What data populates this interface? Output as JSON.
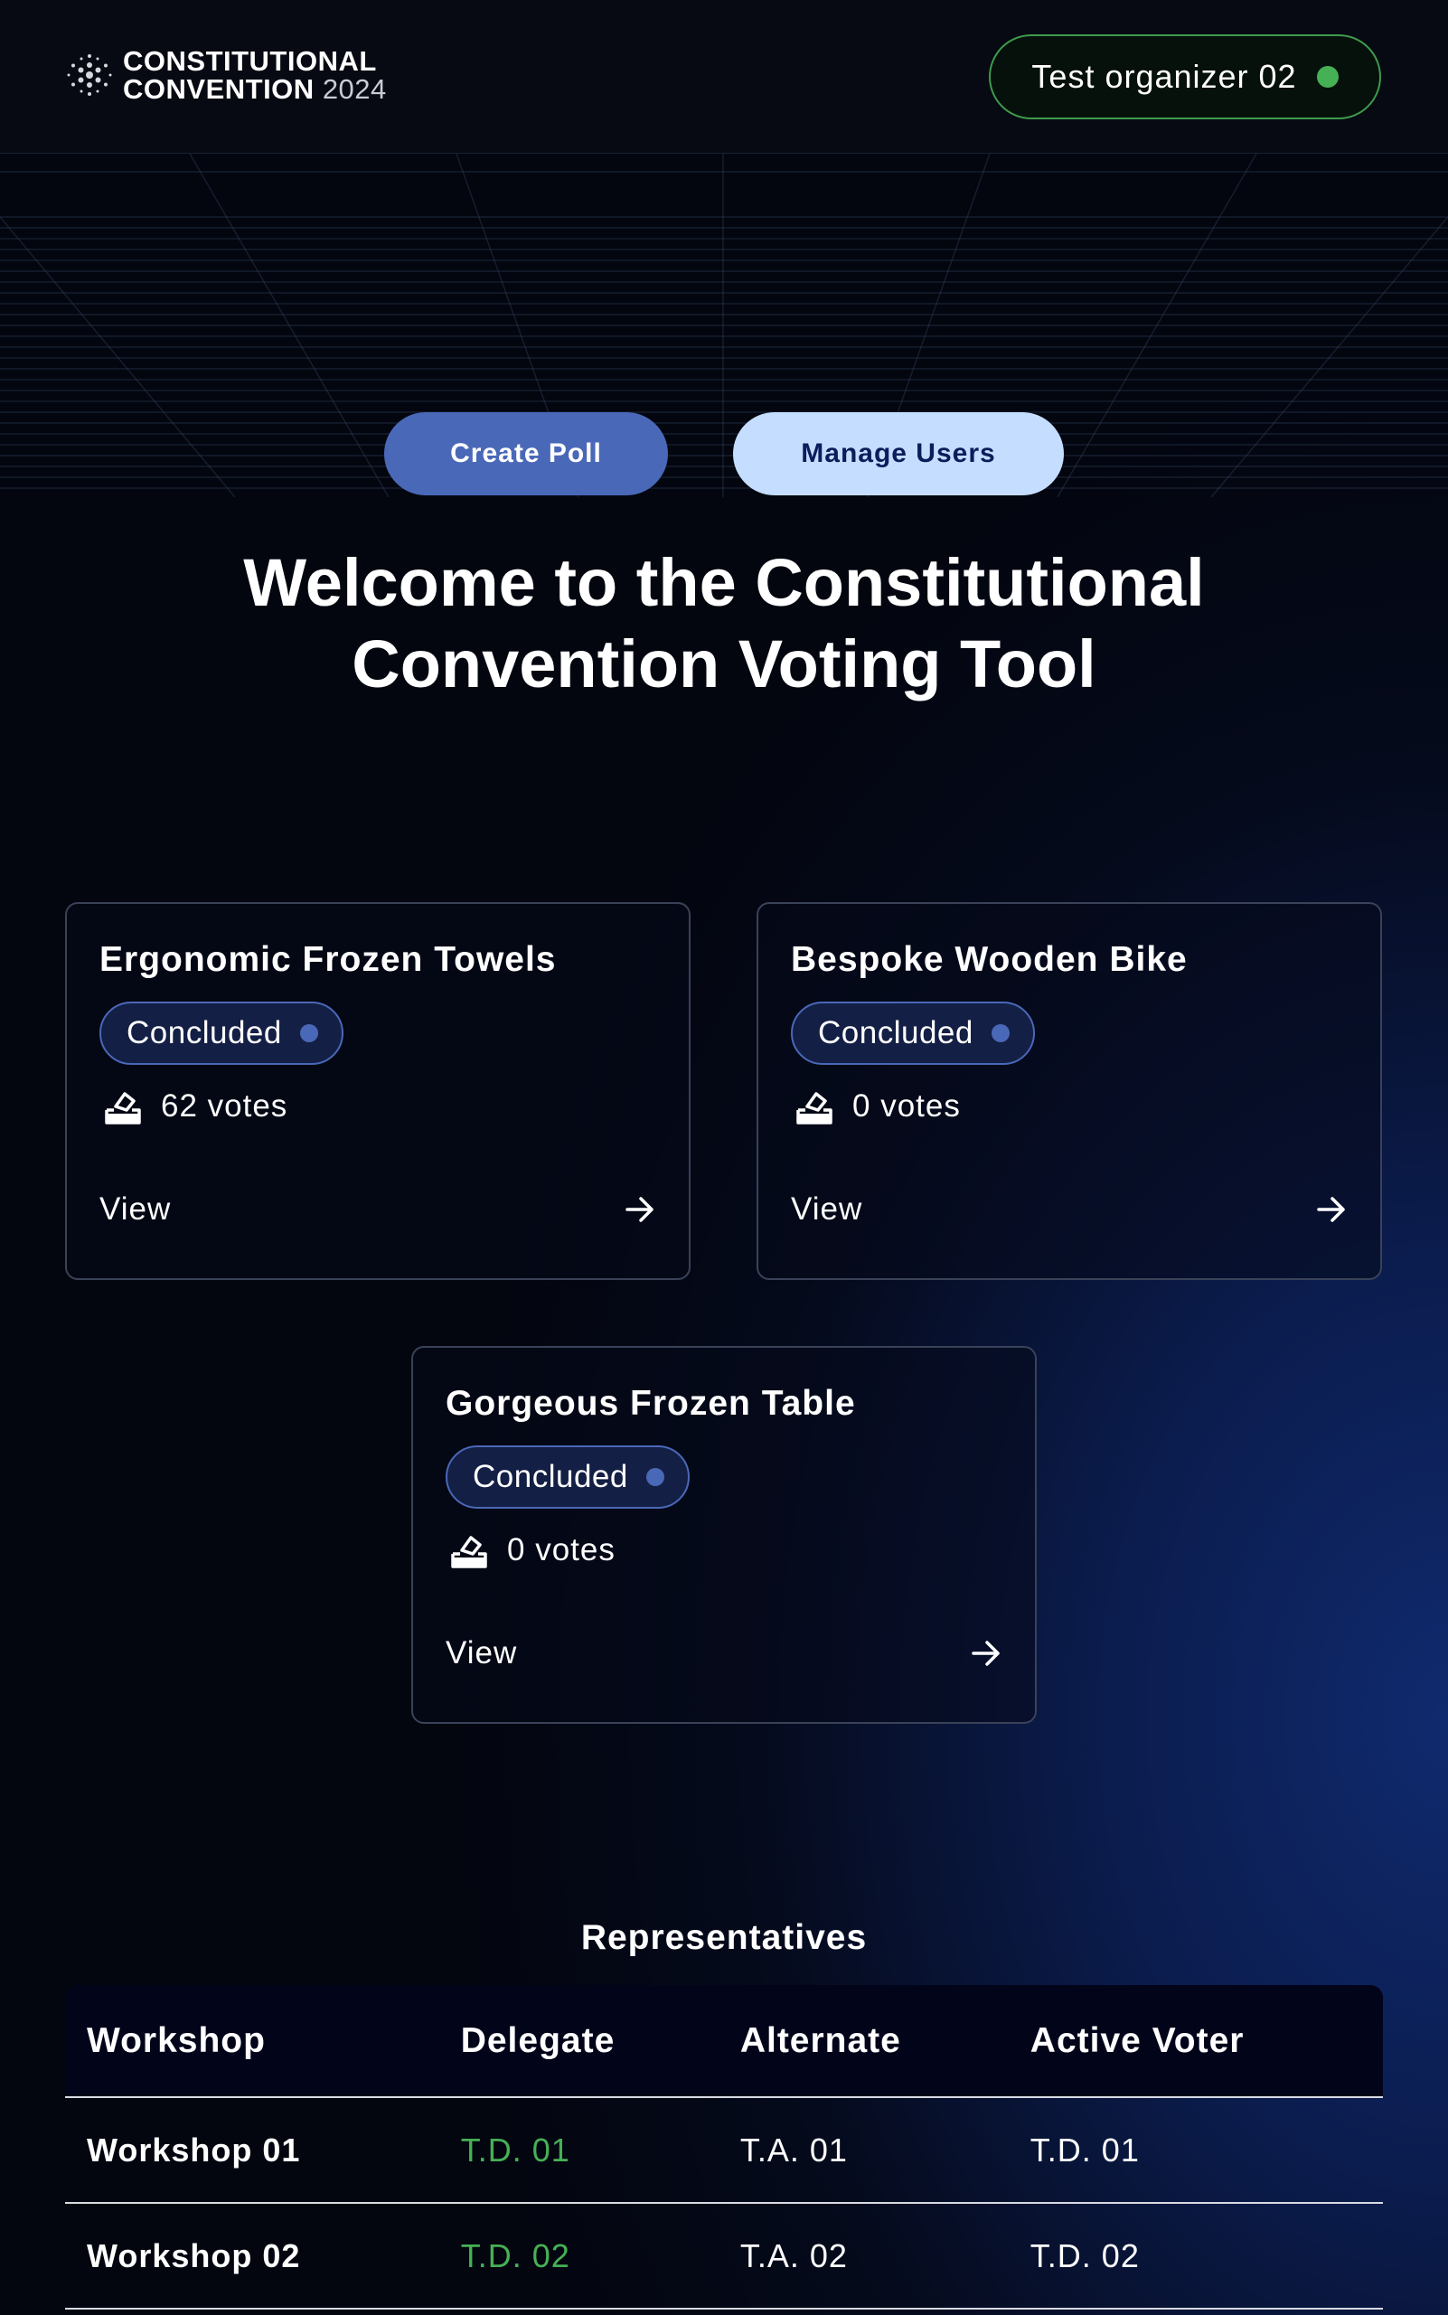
{
  "header": {
    "logo_line1": "CONSTITUTIONAL",
    "logo_line2": "CONVENTION",
    "logo_year": "2024",
    "user_name": "Test organizer 02",
    "user_status_color": "#46b055"
  },
  "actions": {
    "create_poll_label": "Create Poll",
    "manage_users_label": "Manage Users"
  },
  "hero": {
    "title_line1": "Welcome to the Constitutional",
    "title_line2": "Convention Voting Tool"
  },
  "polls": [
    {
      "title": "Ergonomic Frozen Towels",
      "status": "Concluded",
      "votes": "62 votes",
      "link_label": "View"
    },
    {
      "title": "Bespoke Wooden Bike",
      "status": "Concluded",
      "votes": "0 votes",
      "link_label": "View"
    },
    {
      "title": "Gorgeous Frozen Table",
      "status": "Concluded",
      "votes": "0 votes",
      "link_label": "View"
    }
  ],
  "representatives": {
    "title": "Representatives",
    "columns": [
      "Workshop",
      "Delegate",
      "Alternate",
      "Active Voter"
    ],
    "rows": [
      [
        "Workshop 01",
        "T.D. 01",
        "T.A. 01",
        "T.D. 01"
      ],
      [
        "Workshop 02",
        "T.D. 02",
        "T.A. 02",
        "T.D. 02"
      ]
    ]
  },
  "colors": {
    "accent": "#4a68b8",
    "accent_light": "#c5ddff",
    "active_green": "#46b055",
    "background": "#04070f"
  },
  "icons": {
    "logo": "cardano-dots-icon",
    "votes": "ballot-box-icon",
    "view": "arrow-right-icon"
  }
}
